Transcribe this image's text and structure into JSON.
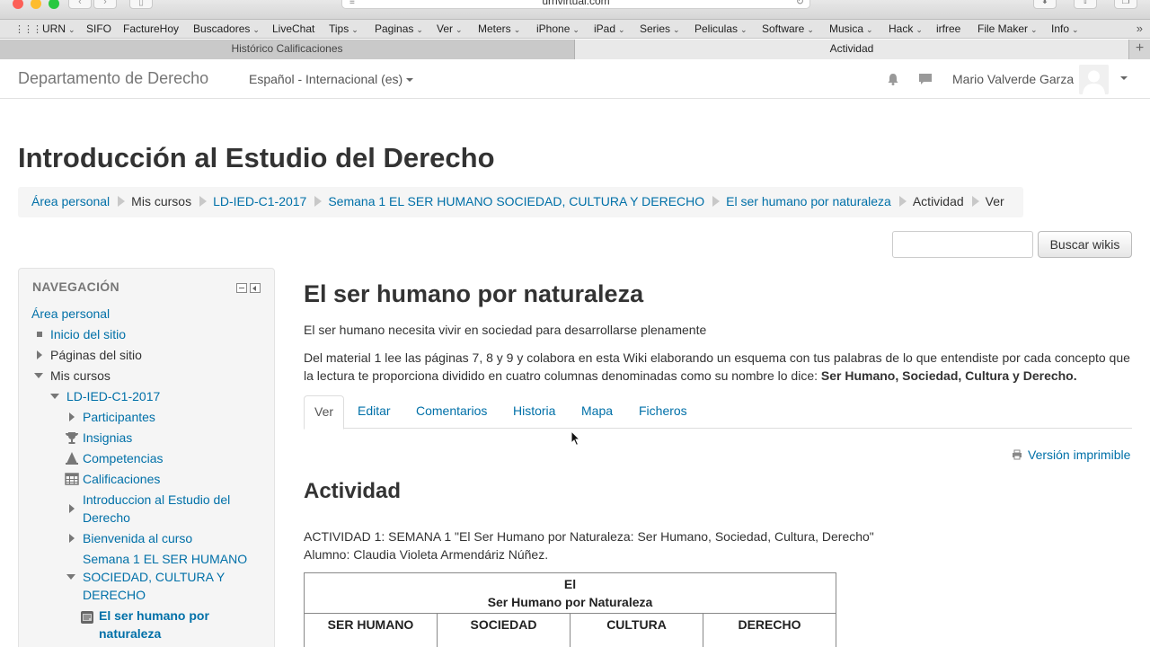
{
  "browser": {
    "url": "urnvirtual.com",
    "bookmarks": [
      {
        "label": "URN",
        "menu": true
      },
      {
        "label": "SIFO",
        "menu": false
      },
      {
        "label": "FactureHoy",
        "menu": false
      },
      {
        "label": "Buscadores",
        "menu": true
      },
      {
        "label": "LiveChat",
        "menu": false
      },
      {
        "label": "Tips",
        "menu": true
      },
      {
        "label": "Paginas",
        "menu": true
      },
      {
        "label": "Ver",
        "menu": true
      },
      {
        "label": "Meters",
        "menu": true
      },
      {
        "label": "iPhone",
        "menu": true
      },
      {
        "label": "iPad",
        "menu": true
      },
      {
        "label": "Series",
        "menu": true
      },
      {
        "label": "Peliculas",
        "menu": true
      },
      {
        "label": "Software",
        "menu": true
      },
      {
        "label": "Musica",
        "menu": true
      },
      {
        "label": "Hack",
        "menu": true
      },
      {
        "label": "irfree",
        "menu": false
      },
      {
        "label": "File Maker",
        "menu": true
      },
      {
        "label": "Info",
        "menu": true
      }
    ],
    "tabs": [
      "Histórico Calificaciones",
      "Actividad"
    ]
  },
  "header": {
    "site_name": "Departamento de Derecho",
    "language": "Español - Internacional (es)",
    "user_name": "Mario Valverde Garza"
  },
  "page": {
    "title": "Introducción al Estudio del Derecho",
    "breadcrumb": [
      {
        "label": "Área personal",
        "link": true
      },
      {
        "label": "Mis cursos",
        "link": false
      },
      {
        "label": "LD-IED-C1-2017",
        "link": true
      },
      {
        "label": "Semana 1 EL SER HUMANO SOCIEDAD, CULTURA Y DERECHO",
        "link": true
      },
      {
        "label": "El ser humano por naturaleza",
        "link": true
      },
      {
        "label": "Actividad",
        "link": false
      },
      {
        "label": "Ver",
        "link": false
      }
    ],
    "search": {
      "placeholder": "",
      "button": "Buscar wikis"
    }
  },
  "navigation": {
    "title": "NAVEGACIÓN",
    "items": {
      "area_personal": "Área personal",
      "inicio": "Inicio del sitio",
      "paginas": "Páginas del sitio",
      "mis_cursos": "Mis cursos",
      "curso": "LD-IED-C1-2017",
      "participantes": "Participantes",
      "insignias": "Insignias",
      "competencias": "Competencias",
      "calificaciones": "Calificaciones",
      "intro_line1": "Introduccion al Estudio del",
      "intro_line2": "Derecho",
      "bienvenida": "Bienvenida al curso",
      "semana_line1": "Semana 1 EL SER HUMANO",
      "semana_line2": "SOCIEDAD, CULTURA Y",
      "semana_line3": "DERECHO",
      "ser_line1": "El ser humano por",
      "ser_line2": "naturaleza"
    }
  },
  "main": {
    "title": "El ser humano por naturaleza",
    "intro": "El ser  humano necesita  vivir en sociedad para desarrollarse plenamente",
    "description": "Del material 1 lee las páginas 7, 8 y 9 y colabora en esta Wiki elaborando un esquema con tus palabras de lo que entendiste por cada concepto que la lectura te proporciona dividido en cuatro columnas denominadas como su nombre lo dice: ",
    "description_bold": "Ser Humano, Sociedad, Cultura y Derecho.",
    "tabs": [
      "Ver",
      "Editar",
      "Comentarios",
      "Historia",
      "Mapa",
      "Ficheros"
    ],
    "print_link": "Versión imprimible",
    "heading": "Actividad",
    "activity_line1": "ACTIVIDAD 1: SEMANA 1 \"El Ser Humano por Naturaleza: Ser Humano, Sociedad, Cultura, Derecho\"",
    "activity_line2": "Alumno: Claudia Violeta Armendáriz Núñez.",
    "table": {
      "header_line1": "El",
      "header_line2": "Ser Humano por Naturaleza",
      "columns": [
        "SER HUMANO",
        "SOCIEDAD",
        "CULTURA",
        "DERECHO"
      ]
    }
  }
}
